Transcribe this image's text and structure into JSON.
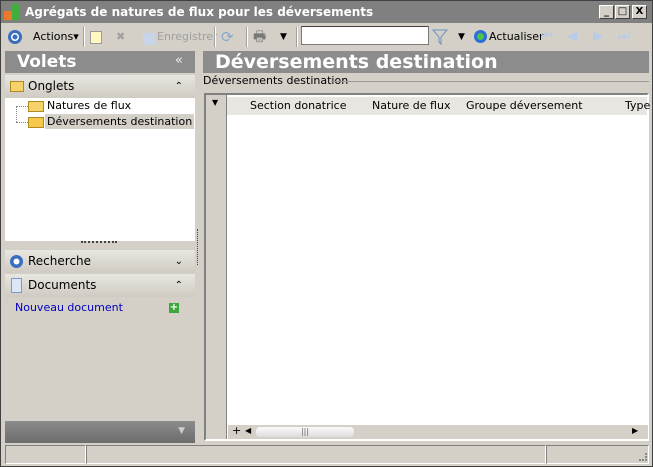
{
  "window": {
    "title": "Agrégats de natures de flux pour les déversements",
    "minimize": "_",
    "maximize": "□",
    "close": "X"
  },
  "toolbar": {
    "actions": "Actions",
    "save": "Enregistrer",
    "search_value": "",
    "refresh": "Actualiser"
  },
  "left": {
    "title": "Volets",
    "collapse": "«",
    "onglets": {
      "label": "Onglets",
      "chevron": "⌃",
      "items": [
        {
          "label": "Natures de flux"
        },
        {
          "label": "Déversements destination"
        }
      ]
    },
    "recherche": {
      "label": "Recherche",
      "chevron": "⌄"
    },
    "documents": {
      "label": "Documents",
      "chevron": "⌃",
      "new_doc": "Nouveau document"
    }
  },
  "main": {
    "title": "Déversements destination",
    "group_label": "Déversements destination",
    "columns": [
      "Section donatrice",
      "Nature de flux",
      "Groupe déversement",
      "Type"
    ],
    "add": "+"
  }
}
